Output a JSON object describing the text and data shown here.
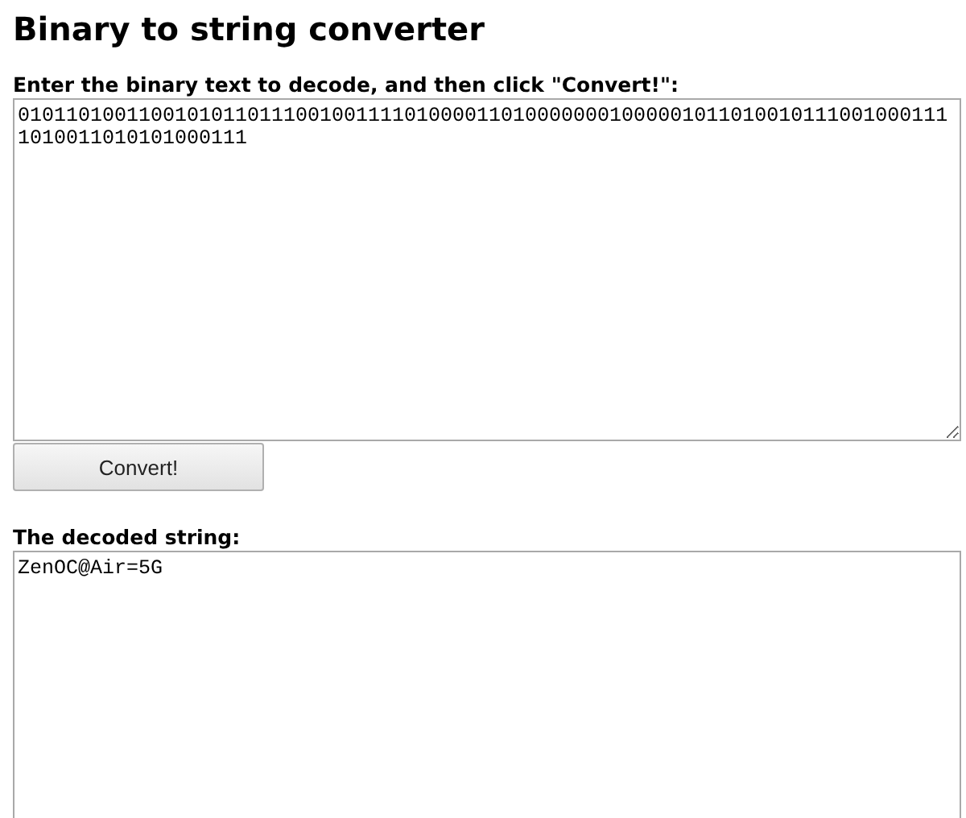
{
  "title": "Binary to string converter",
  "input": {
    "label": "Enter the binary text to decode, and then click \"Convert!\":",
    "value": "010110100110010101101110010011110100001101000000010000010110100101110010001111010011010101000111"
  },
  "convert_button": "Convert!",
  "output": {
    "label": "The decoded string:",
    "value": "ZenOC@Air=5G"
  }
}
